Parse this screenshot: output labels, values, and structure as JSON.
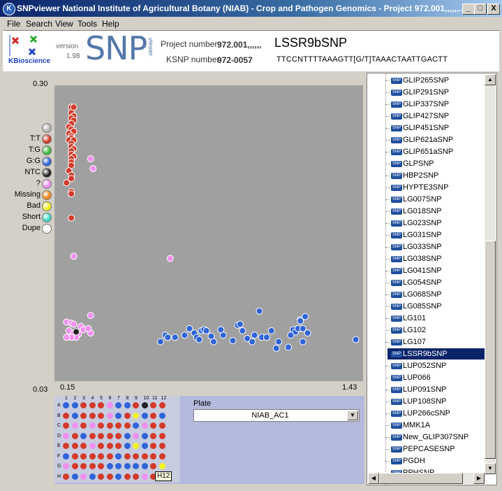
{
  "window": {
    "title": "SNPviewer  National Institute of Agricultural Botany (NIAB) - Crop and Pathogen Genomics - Project 972.001,,,,,,...",
    "buttons": [
      "_",
      "□",
      "X"
    ]
  },
  "menu": [
    "File",
    "Search",
    "View",
    "Tools",
    "Help"
  ],
  "header": {
    "logo_text": "KBioscience",
    "version_label": "version",
    "version_value": "1.98",
    "snp_logo": "SNP",
    "snp_logo_sub": "viewer",
    "project_label": "Project number",
    "project_value": "972.001,,,,,,",
    "ksnp_label": "KSNP number",
    "ksnp_value": "972-0057",
    "snp_name": "LSSR9bSNP",
    "sequence": "TTCCNTTTTAAAGTT[G/T]TAAACTAATTGACTT"
  },
  "legend": [
    {
      "label": "",
      "color": "#b5b5b5"
    },
    {
      "label": "T:T",
      "color": "#d43a2a"
    },
    {
      "label": "T:G",
      "color": "#3cb83c"
    },
    {
      "label": "G:G",
      "color": "#2f63d8"
    },
    {
      "label": "NTC",
      "color": "#222222"
    },
    {
      "label": "?",
      "color": "#f090f0"
    },
    {
      "label": "Missing",
      "color": "#f5891f"
    },
    {
      "label": "Bad",
      "color": "#f3f320"
    },
    {
      "label": "Short",
      "color": "#3cd8c0"
    },
    {
      "label": "Dupe",
      "color": "#f8f8f8"
    }
  ],
  "chart_data": {
    "type": "scatter",
    "y_top_label": "0.30",
    "y_bottom_label": "0.03",
    "x_left_label": "0.15",
    "x_right_label": "1.43",
    "xlim": [
      0.15,
      1.43
    ],
    "ylim": [
      0.03,
      0.3
    ],
    "series": [
      {
        "name": "T:T",
        "color": "#d43a2a",
        "points": [
          [
            0.22,
            0.28
          ],
          [
            0.23,
            0.28
          ],
          [
            0.22,
            0.275
          ],
          [
            0.23,
            0.272
          ],
          [
            0.22,
            0.27
          ],
          [
            0.23,
            0.268
          ],
          [
            0.22,
            0.265
          ],
          [
            0.21,
            0.262
          ],
          [
            0.22,
            0.26
          ],
          [
            0.23,
            0.258
          ],
          [
            0.21,
            0.256
          ],
          [
            0.22,
            0.254
          ],
          [
            0.22,
            0.252
          ],
          [
            0.21,
            0.25
          ],
          [
            0.23,
            0.25
          ],
          [
            0.22,
            0.247
          ],
          [
            0.22,
            0.244
          ],
          [
            0.23,
            0.242
          ],
          [
            0.22,
            0.24
          ],
          [
            0.22,
            0.237
          ],
          [
            0.23,
            0.235
          ],
          [
            0.22,
            0.233
          ],
          [
            0.22,
            0.23
          ],
          [
            0.22,
            0.227
          ],
          [
            0.21,
            0.222
          ],
          [
            0.22,
            0.218
          ],
          [
            0.22,
            0.215
          ],
          [
            0.2,
            0.211
          ],
          [
            0.22,
            0.203
          ],
          [
            0.22,
            0.201
          ],
          [
            0.22,
            0.179
          ]
        ]
      },
      {
        "name": "?",
        "color": "#f090f0",
        "points": [
          [
            0.3,
            0.233
          ],
          [
            0.31,
            0.224
          ],
          [
            0.23,
            0.144
          ],
          [
            0.63,
            0.142
          ],
          [
            0.3,
            0.09
          ],
          [
            0.2,
            0.084
          ],
          [
            0.22,
            0.083
          ],
          [
            0.23,
            0.082
          ],
          [
            0.26,
            0.08
          ],
          [
            0.21,
            0.076
          ],
          [
            0.23,
            0.074
          ],
          [
            0.25,
            0.073
          ],
          [
            0.24,
            0.07
          ],
          [
            0.22,
            0.07
          ],
          [
            0.2,
            0.07
          ],
          [
            0.3,
            0.074
          ],
          [
            0.27,
            0.077
          ],
          [
            0.29,
            0.078
          ]
        ]
      },
      {
        "name": "NTC",
        "color": "#222222",
        "points": [
          [
            0.24,
            0.075
          ]
        ]
      },
      {
        "name": "G:G",
        "color": "#2f63d8",
        "points": [
          [
            0.59,
            0.066
          ],
          [
            0.61,
            0.072
          ],
          [
            0.62,
            0.07
          ],
          [
            0.65,
            0.07
          ],
          [
            0.69,
            0.072
          ],
          [
            0.71,
            0.078
          ],
          [
            0.73,
            0.074
          ],
          [
            0.74,
            0.07
          ],
          [
            0.75,
            0.068
          ],
          [
            0.76,
            0.076
          ],
          [
            0.77,
            0.077
          ],
          [
            0.78,
            0.076
          ],
          [
            0.8,
            0.071
          ],
          [
            0.81,
            0.066
          ],
          [
            0.84,
            0.077
          ],
          [
            0.85,
            0.072
          ],
          [
            0.89,
            0.067
          ],
          [
            0.91,
            0.081
          ],
          [
            0.92,
            0.082
          ],
          [
            0.93,
            0.076
          ],
          [
            0.95,
            0.069
          ],
          [
            0.97,
            0.066
          ],
          [
            0.98,
            0.072
          ],
          [
            1.0,
            0.094
          ],
          [
            1.01,
            0.07
          ],
          [
            1.03,
            0.07
          ],
          [
            1.05,
            0.076
          ],
          [
            1.07,
            0.06
          ],
          [
            1.08,
            0.066
          ],
          [
            1.13,
            0.072
          ],
          [
            1.14,
            0.077
          ],
          [
            1.15,
            0.075
          ],
          [
            1.16,
            0.078
          ],
          [
            1.18,
            0.078
          ],
          [
            1.18,
            0.066
          ],
          [
            1.2,
            0.074
          ],
          [
            1.17,
            0.086
          ],
          [
            1.19,
            0.089
          ],
          [
            1.4,
            0.068
          ],
          [
            1.17,
            0.085
          ],
          [
            1.12,
            0.061
          ]
        ]
      }
    ]
  },
  "plate": {
    "columns": [
      "1",
      "2",
      "3",
      "4",
      "5",
      "6",
      "7",
      "8",
      "9",
      "10",
      "11",
      "12"
    ],
    "rows": [
      "A",
      "B",
      "C",
      "D",
      "E",
      "F",
      "G",
      "H"
    ],
    "wells": [
      [
        "b",
        "b",
        "r",
        "r",
        "r",
        "p",
        "b",
        "b",
        "r",
        "k",
        "r",
        "r"
      ],
      [
        "r",
        "b",
        "r",
        "r",
        "r",
        "p",
        "b",
        "r",
        "y",
        "b",
        "r",
        "b"
      ],
      [
        "r",
        "p",
        "r",
        "p",
        "r",
        "r",
        "r",
        "r",
        "b",
        "p",
        "r",
        "r"
      ],
      [
        "p",
        "r",
        "b",
        "r",
        "r",
        "r",
        "r",
        "b",
        "p",
        "b",
        "r",
        "r"
      ],
      [
        "r",
        "r",
        "r",
        "p",
        "r",
        "r",
        "r",
        "b",
        "y",
        "b",
        "r",
        "r"
      ],
      [
        "b",
        "r",
        "r",
        "r",
        "r",
        "r",
        "b",
        "r",
        "r",
        "r",
        "r",
        "r"
      ],
      [
        "p",
        "r",
        "r",
        "r",
        "r",
        "b",
        "b",
        "b",
        "b",
        "b",
        "r",
        "y"
      ],
      [
        "r",
        "b",
        "p",
        "b",
        "r",
        "r",
        "b",
        "r",
        "r",
        "p",
        "r",
        "r"
      ]
    ],
    "well_colors": {
      "b": "#2f63d8",
      "r": "#d43a2a",
      "p": "#f090f0",
      "k": "#222222",
      "y": "#f3f320"
    },
    "tooltip": "H12",
    "plate_label": "Plate",
    "plate_value": "NIAB_AC1"
  },
  "snp_list": {
    "items": [
      "GLIP265SNP",
      "GLIP291SNP",
      "GLIP337SNP",
      "GLIP427SNP",
      "GLIP451SNP",
      "GLIP621aSNP",
      "GLIP651aSNP",
      "GLPSNP",
      "HBP2SNP",
      "HYPTE3SNP",
      "LG007SNP",
      "LG018SNP",
      "LG023SNP",
      "LG031SNP",
      "LG033SNP",
      "LG038SNP",
      "LG041SNP",
      "LG054SNP",
      "LG068SNP",
      "LG085SNP",
      "LG101",
      "LG102",
      "LG107",
      "LSSR9bSNP",
      "LUP052SNP",
      "LUP066",
      "LUP091SNP",
      "LUP108SNP",
      "LUP266cSNP",
      "MMK1A",
      "New_GLIP307SNP",
      "PEPCASESNP",
      "PGDH",
      "PPHSNP"
    ],
    "selected": "LSSR9bSNP",
    "icon_text": "SNP"
  }
}
